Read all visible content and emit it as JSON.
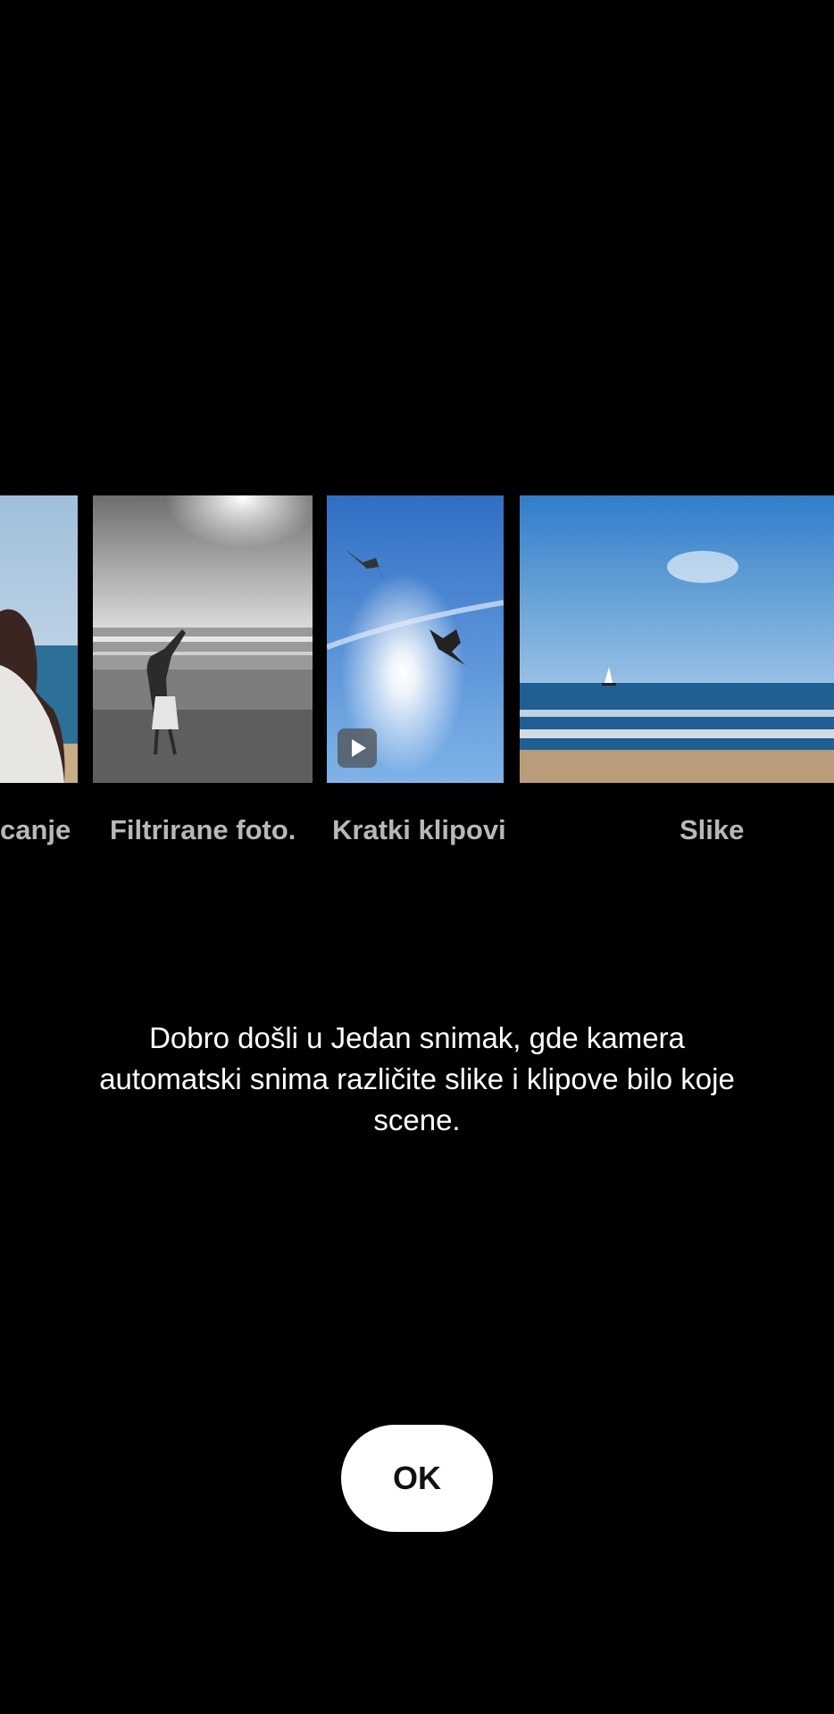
{
  "carousel": {
    "items": [
      {
        "label": "canje",
        "thumbnail": "portrait-beach-photo"
      },
      {
        "label": "Filtrirane foto.",
        "thumbnail": "black-and-white-beach-photo"
      },
      {
        "label": "Kratki klipovi",
        "thumbnail": "seagulls-sky-clip",
        "badge_icon": "play-icon"
      },
      {
        "label": "Slike",
        "thumbnail": "sailboat-sea-photo"
      }
    ]
  },
  "message": {
    "text": "Dobro došli u Jedan snimak, gde kamera automatski snima različite slike i klipove bilo koje scene."
  },
  "ok_button": {
    "label": "OK"
  },
  "colors": {
    "background": "#000000",
    "label_text": "#b8b8b8",
    "button_bg": "#ffffff"
  }
}
